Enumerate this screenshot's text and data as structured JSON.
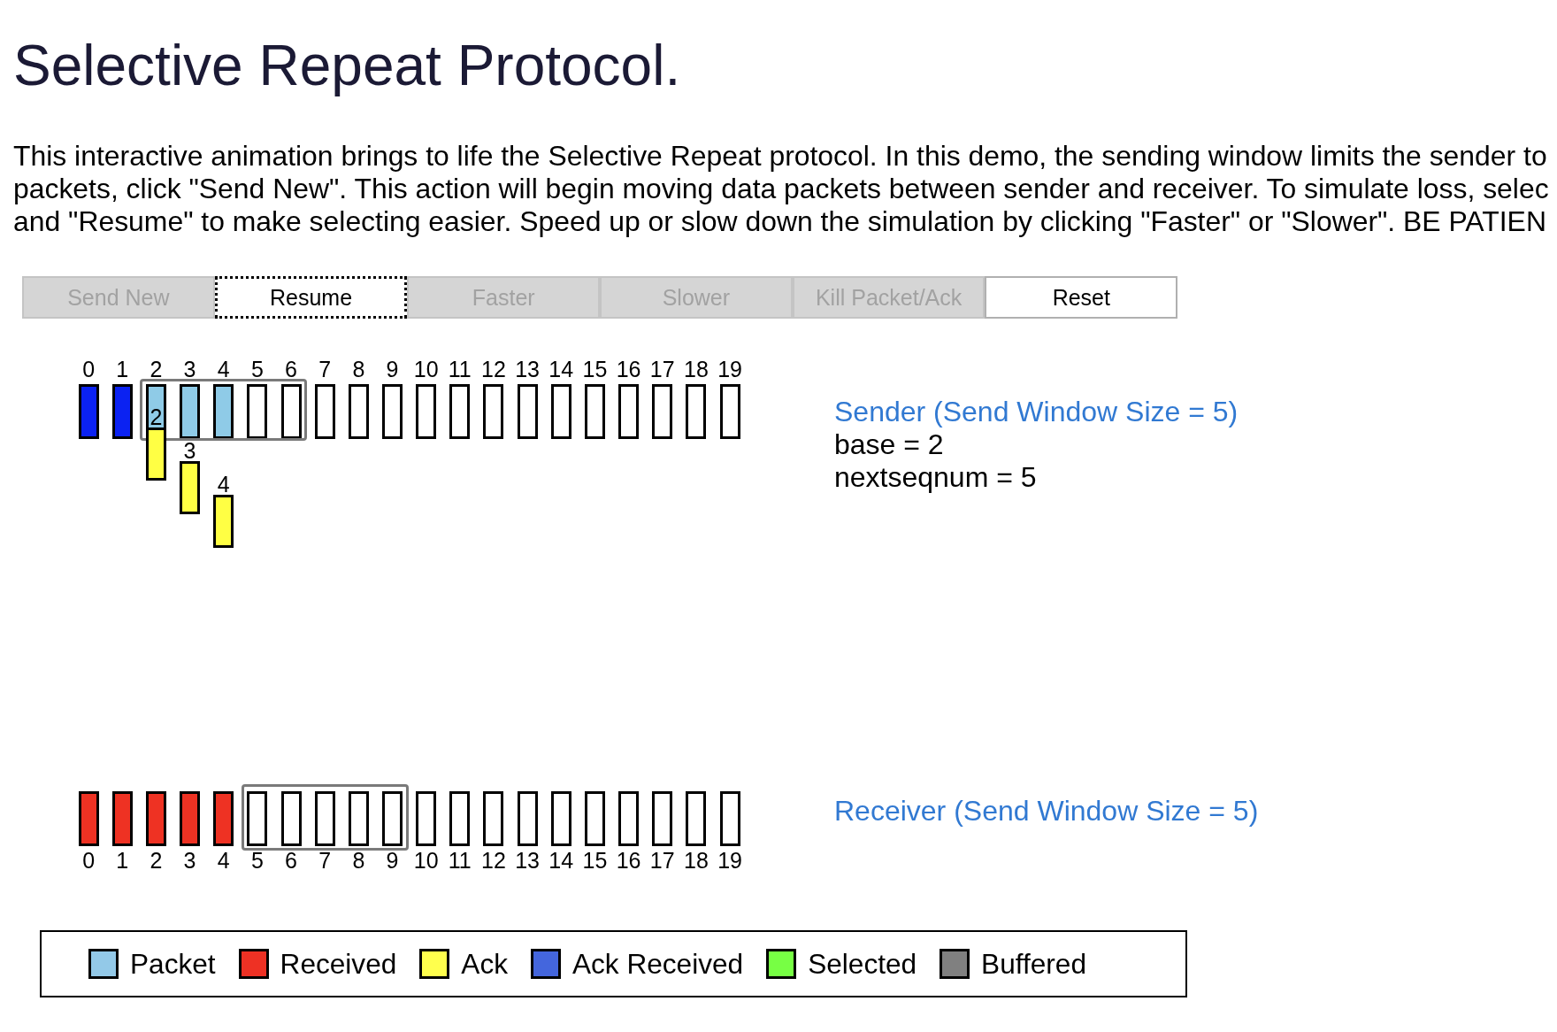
{
  "title": "Selective Repeat Protocol.",
  "intro": {
    "lines": [
      "This interactive animation brings to life the Selective Repeat protocol. In this demo, the sending window limits the sender to",
      "packets, click \"Send New\". This action will begin moving data packets between sender and receiver. To simulate loss, selec",
      "and \"Resume\" to make selecting easier. Speed up or slow down the simulation by clicking \"Faster\" or \"Slower\". BE PATIEN"
    ]
  },
  "buttons": [
    {
      "label": "Send New",
      "disabled": true,
      "focused": false
    },
    {
      "label": "Resume",
      "disabled": false,
      "focused": true
    },
    {
      "label": "Faster",
      "disabled": true,
      "focused": false
    },
    {
      "label": "Slower",
      "disabled": true,
      "focused": false
    },
    {
      "label": "Kill Packet/Ack",
      "disabled": true,
      "focused": false
    },
    {
      "label": "Reset",
      "disabled": false,
      "focused": false
    }
  ],
  "sender": {
    "slots": [
      {
        "label": "0",
        "color": "#0b22f2",
        "in_window": false
      },
      {
        "label": "1",
        "color": "#0b22f2",
        "in_window": false
      },
      {
        "label": "2",
        "color": "#8fcbe7",
        "in_window": true,
        "ack": {
          "label": "2"
        }
      },
      {
        "label": "3",
        "color": "#8fcbe7",
        "in_window": true,
        "ack": {
          "label": "3"
        }
      },
      {
        "label": "4",
        "color": "#8fcbe7",
        "in_window": true,
        "ack": {
          "label": "4"
        }
      },
      {
        "label": "5",
        "color": "#ffffff",
        "in_window": true
      },
      {
        "label": "6",
        "color": "#ffffff",
        "in_window": true
      },
      {
        "label": "7",
        "color": "#ffffff",
        "in_window": false
      },
      {
        "label": "8",
        "color": "#ffffff",
        "in_window": false
      },
      {
        "label": "9",
        "color": "#ffffff",
        "in_window": false
      },
      {
        "label": "10",
        "color": "#ffffff",
        "in_window": false
      },
      {
        "label": "11",
        "color": "#ffffff",
        "in_window": false
      },
      {
        "label": "12",
        "color": "#ffffff",
        "in_window": false
      },
      {
        "label": "13",
        "color": "#ffffff",
        "in_window": false
      },
      {
        "label": "14",
        "color": "#ffffff",
        "in_window": false
      },
      {
        "label": "15",
        "color": "#ffffff",
        "in_window": false
      },
      {
        "label": "16",
        "color": "#ffffff",
        "in_window": false
      },
      {
        "label": "17",
        "color": "#ffffff",
        "in_window": false
      },
      {
        "label": "18",
        "color": "#ffffff",
        "in_window": false
      },
      {
        "label": "19",
        "color": "#ffffff",
        "in_window": false
      }
    ],
    "title": "Sender (Send Window Size = 5)",
    "lines": [
      "base = 2",
      "nextseqnum = 5"
    ]
  },
  "receiver": {
    "slots": [
      {
        "label": "0",
        "color": "#ee3223",
        "in_window": false
      },
      {
        "label": "1",
        "color": "#ee3223",
        "in_window": false
      },
      {
        "label": "2",
        "color": "#ee3223",
        "in_window": false
      },
      {
        "label": "3",
        "color": "#ee3223",
        "in_window": false
      },
      {
        "label": "4",
        "color": "#ee3223",
        "in_window": false
      },
      {
        "label": "5",
        "color": "#ffffff",
        "in_window": true
      },
      {
        "label": "6",
        "color": "#ffffff",
        "in_window": true
      },
      {
        "label": "7",
        "color": "#ffffff",
        "in_window": true
      },
      {
        "label": "8",
        "color": "#ffffff",
        "in_window": true
      },
      {
        "label": "9",
        "color": "#ffffff",
        "in_window": true
      },
      {
        "label": "10",
        "color": "#ffffff",
        "in_window": false
      },
      {
        "label": "11",
        "color": "#ffffff",
        "in_window": false
      },
      {
        "label": "12",
        "color": "#ffffff",
        "in_window": false
      },
      {
        "label": "13",
        "color": "#ffffff",
        "in_window": false
      },
      {
        "label": "14",
        "color": "#ffffff",
        "in_window": false
      },
      {
        "label": "15",
        "color": "#ffffff",
        "in_window": false
      },
      {
        "label": "16",
        "color": "#ffffff",
        "in_window": false
      },
      {
        "label": "17",
        "color": "#ffffff",
        "in_window": false
      },
      {
        "label": "18",
        "color": "#ffffff",
        "in_window": false
      },
      {
        "label": "19",
        "color": "#ffffff",
        "in_window": false
      }
    ],
    "title": "Receiver (Send Window Size = 5)"
  },
  "legend": [
    {
      "label": "Packet",
      "color": "#93c9e8"
    },
    {
      "label": "Received",
      "color": "#ee3124"
    },
    {
      "label": "Ack",
      "color": "#ffff4d"
    },
    {
      "label": "Ack Received",
      "color": "#4466dd"
    },
    {
      "label": "Selected",
      "color": "#77ff44"
    },
    {
      "label": "Buffered",
      "color": "#808080"
    }
  ]
}
